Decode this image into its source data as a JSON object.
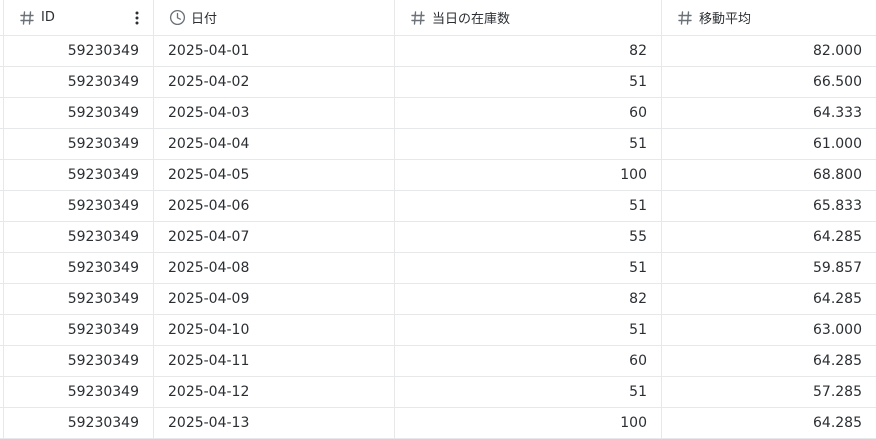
{
  "columns": [
    {
      "label": "ID",
      "icon": "hash-icon"
    },
    {
      "label": "日付",
      "icon": "clock-icon"
    },
    {
      "label": "当日の在庫数",
      "icon": "hash-icon"
    },
    {
      "label": "移動平均",
      "icon": "hash-icon"
    }
  ],
  "rows": [
    {
      "id": "59230349",
      "date": "2025-04-01",
      "stock": "82",
      "avg": "82.000"
    },
    {
      "id": "59230349",
      "date": "2025-04-02",
      "stock": "51",
      "avg": "66.500"
    },
    {
      "id": "59230349",
      "date": "2025-04-03",
      "stock": "60",
      "avg": "64.333"
    },
    {
      "id": "59230349",
      "date": "2025-04-04",
      "stock": "51",
      "avg": "61.000"
    },
    {
      "id": "59230349",
      "date": "2025-04-05",
      "stock": "100",
      "avg": "68.800"
    },
    {
      "id": "59230349",
      "date": "2025-04-06",
      "stock": "51",
      "avg": "65.833"
    },
    {
      "id": "59230349",
      "date": "2025-04-07",
      "stock": "55",
      "avg": "64.285"
    },
    {
      "id": "59230349",
      "date": "2025-04-08",
      "stock": "51",
      "avg": "59.857"
    },
    {
      "id": "59230349",
      "date": "2025-04-09",
      "stock": "82",
      "avg": "64.285"
    },
    {
      "id": "59230349",
      "date": "2025-04-10",
      "stock": "51",
      "avg": "63.000"
    },
    {
      "id": "59230349",
      "date": "2025-04-11",
      "stock": "60",
      "avg": "64.285"
    },
    {
      "id": "59230349",
      "date": "2025-04-12",
      "stock": "51",
      "avg": "57.285"
    },
    {
      "id": "59230349",
      "date": "2025-04-13",
      "stock": "100",
      "avg": "64.285"
    }
  ]
}
